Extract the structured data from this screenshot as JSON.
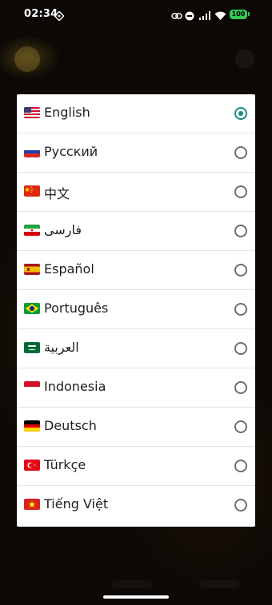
{
  "status_bar": {
    "time": "02:34",
    "battery": "100",
    "icons": [
      "nfc-icon",
      "link-icon",
      "do-not-disturb-icon",
      "signal-icon",
      "wifi-icon",
      "battery-icon"
    ]
  },
  "language_dialog": {
    "selected": "English",
    "accent_color": "#1a8b80",
    "options": [
      {
        "label": "English",
        "flag": "us-flag-icon",
        "selected": true
      },
      {
        "label": "Русский",
        "flag": "russia-flag-icon",
        "selected": false
      },
      {
        "label": "中文",
        "flag": "china-flag-icon",
        "selected": false
      },
      {
        "label": "فارسی",
        "flag": "iran-flag-icon",
        "selected": false
      },
      {
        "label": "Español",
        "flag": "spain-flag-icon",
        "selected": false
      },
      {
        "label": "Português",
        "flag": "brazil-flag-icon",
        "selected": false
      },
      {
        "label": "العربية",
        "flag": "saudi-arabia-flag-icon",
        "selected": false
      },
      {
        "label": "Indonesia",
        "flag": "indonesia-flag-icon",
        "selected": false
      },
      {
        "label": "Deutsch",
        "flag": "germany-flag-icon",
        "selected": false
      },
      {
        "label": "Türkçe",
        "flag": "turkey-flag-icon",
        "selected": false
      },
      {
        "label": "Tiếng Việt",
        "flag": "vietnam-flag-icon",
        "selected": false
      }
    ]
  }
}
